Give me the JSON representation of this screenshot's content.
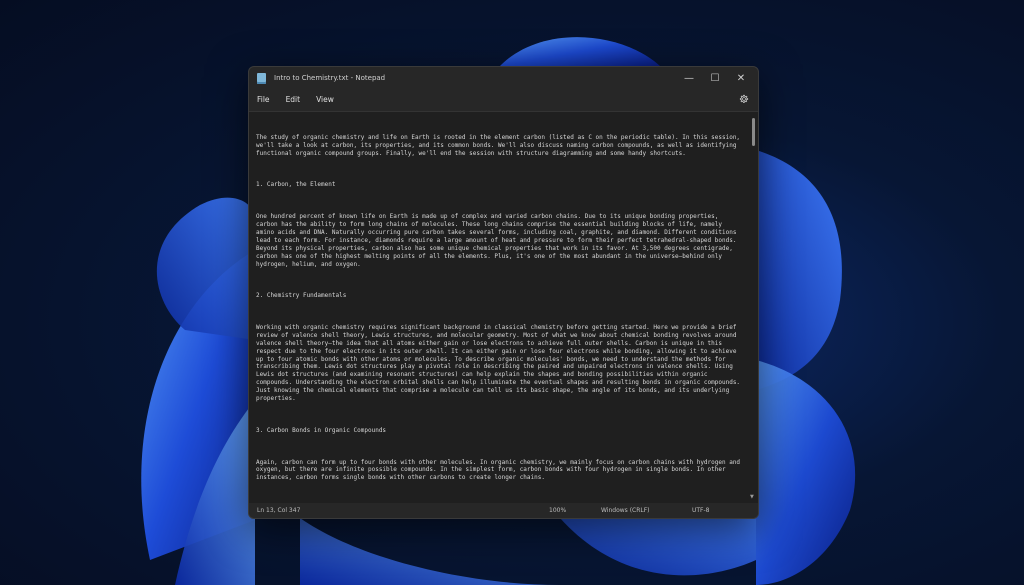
{
  "window": {
    "title": "Intro to Chemistry.txt - Notepad",
    "controls": {
      "minimize": "—",
      "maximize": "☐",
      "close": "✕"
    }
  },
  "menu": {
    "items": [
      {
        "label": "File"
      },
      {
        "label": "Edit"
      },
      {
        "label": "View"
      }
    ]
  },
  "document": {
    "paragraphs": [
      "The study of organic chemistry and life on Earth is rooted in the element carbon (listed as C on the periodic table). In this session, we'll take a look at carbon, its properties, and its common bonds. We'll also discuss naming carbon compounds, as well as identifying functional organic compound groups. Finally, we'll end the session with structure diagramming and some handy shortcuts.",
      "1. Carbon, the Element",
      "One hundred percent of known life on Earth is made up of complex and varied carbon chains. Due to its unique bonding properties, carbon has the ability to form long chains of molecules. These long chains comprise the essential building blocks of life, namely amino acids and DNA. Naturally occurring pure carbon takes several forms, including coal, graphite, and diamond. Different conditions lead to each form. For instance, diamonds require a large amount of heat and pressure to form their perfect tetrahedral-shaped bonds. Beyond its physical properties, carbon also has some unique chemical properties that work in its favor. At 3,500 degrees centigrade, carbon has one of the highest melting points of all the elements. Plus, it's one of the most abundant in the universe—behind only hydrogen, helium, and oxygen.",
      "2. Chemistry Fundamentals",
      "Working with organic chemistry requires significant background in classical chemistry before getting started. Here we provide a brief review of valence shell theory, Lewis structures, and molecular geometry. Most of what we know about chemical bonding revolves around valence shell theory—the idea that all atoms either gain or lose electrons to achieve full outer shells. Carbon is unique in this respect due to the four electrons in its outer shell. It can either gain or lose four electrons while bonding, allowing it to achieve up to four atomic bonds with other atoms or molecules. To describe organic molecules' bonds, we need to understand the methods for transcribing them. Lewis dot structures play a pivotal role in describing the paired and unpaired electrons in valence shells. Using Lewis dot structures (and examining resonant structures) can help explain the shapes and bonding possibilities within organic compounds. Understanding the electron orbital shells can help illuminate the eventual shapes and resulting bonds in organic compounds. Just knowing the chemical elements that comprise a molecule can tell us its basic shape, the angle of its bonds, and its underlying properties.",
      "3. Carbon Bonds in Organic Compounds",
      "Again, carbon can form up to four bonds with other molecules. In organic chemistry, we mainly focus on carbon chains with hydrogen and oxygen, but there are infinite possible compounds. In the simplest form, carbon bonds with four hydrogen in single bonds. In other instances, carbon forms single bonds with other carbons to create longer chains."
    ]
  },
  "status": {
    "position": "Ln 13, Col 347",
    "zoom": "100%",
    "line_ending": "Windows (CRLF)",
    "encoding": "UTF-8"
  },
  "icons": {
    "app": "notepad-icon",
    "settings": "gear-icon"
  },
  "colors": {
    "window_bg": "#272727",
    "editor_bg": "#1f1f1f",
    "text": "#d6d6d6",
    "wallpaper_accent": "#1e5bff"
  }
}
